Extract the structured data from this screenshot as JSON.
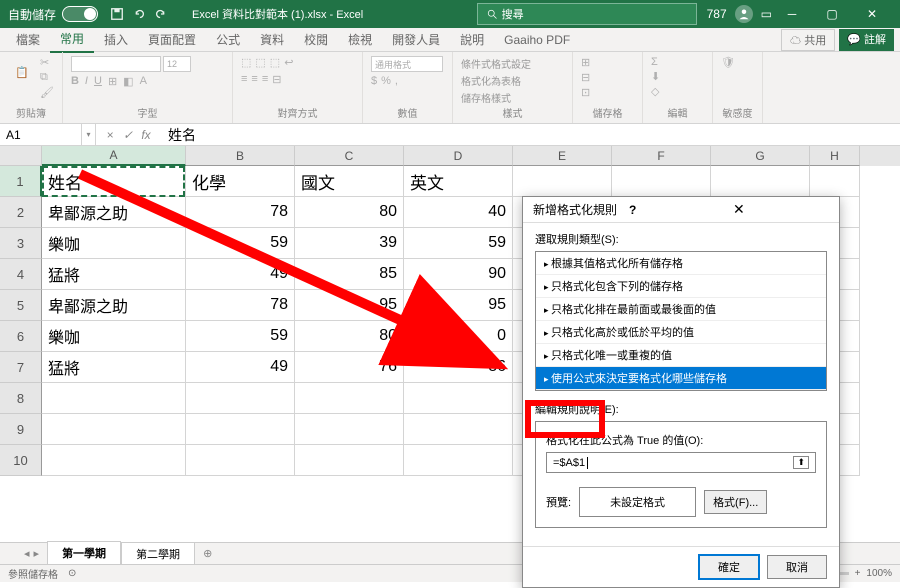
{
  "titlebar": {
    "autosave_label": "自動儲存",
    "autosave_state": "關閉",
    "title": "Excel 資料比對範本 (1).xlsx  -  Excel",
    "search_placeholder": "搜尋",
    "user": "787"
  },
  "menu": {
    "file": "檔案",
    "home": "常用",
    "insert": "插入",
    "layout": "頁面配置",
    "formulas": "公式",
    "data": "資料",
    "review": "校閱",
    "view": "檢視",
    "developer": "開發人員",
    "help": "說明",
    "gaaiho": "Gaaiho PDF",
    "share": "共用",
    "comment": "註解"
  },
  "ribbon": {
    "clipboard": "剪貼簿",
    "font": "字型",
    "alignment": "對齊方式",
    "number": "數值",
    "styles": "樣式",
    "cells": "儲存格",
    "editing": "編輯",
    "sensitivity": "敏感度",
    "numfmt": "通用格式",
    "style1": "條件式格式設定",
    "style2": "格式化為表格",
    "style3": "儲存格樣式"
  },
  "namebox": {
    "ref": "A1",
    "formula": "姓名"
  },
  "columns": [
    "A",
    "B",
    "C",
    "D",
    "E",
    "F",
    "G",
    "H"
  ],
  "rows": [
    "1",
    "2",
    "3",
    "4",
    "5",
    "6",
    "7",
    "8",
    "9",
    "10"
  ],
  "table": {
    "header": [
      "姓名",
      "化學",
      "國文",
      "英文"
    ],
    "body": [
      [
        "卑鄙源之助",
        "78",
        "80",
        "40"
      ],
      [
        "樂咖",
        "59",
        "39",
        "59"
      ],
      [
        "猛將",
        "49",
        "85",
        "90"
      ],
      [
        "卑鄙源之助",
        "78",
        "95",
        "95"
      ],
      [
        "樂咖",
        "59",
        "80",
        "0"
      ],
      [
        "猛將",
        "49",
        "76",
        "86"
      ]
    ]
  },
  "dialog": {
    "title": "新增格式化規則",
    "select_label": "選取規則類型(S):",
    "rules": [
      "根據其值格式化所有儲存格",
      "只格式化包含下列的儲存格",
      "只格式化排在最前面或最後面的值",
      "只格式化高於或低於平均的值",
      "只格式化唯一或重複的值",
      "使用公式來決定要格式化哪些儲存格"
    ],
    "edit_label": "編輯規則說明(E):",
    "formula_label": "格式化在此公式為 True 的值(O):",
    "formula_value": "=$A$1",
    "preview_label": "預覽:",
    "preview_value": "未設定格式",
    "format_btn": "格式(F)...",
    "ok": "確定",
    "cancel": "取消"
  },
  "sheets": {
    "s1": "第一學期",
    "s2": "第二學期"
  },
  "status": {
    "mode": "參照儲存格",
    "zoom": "100%"
  }
}
